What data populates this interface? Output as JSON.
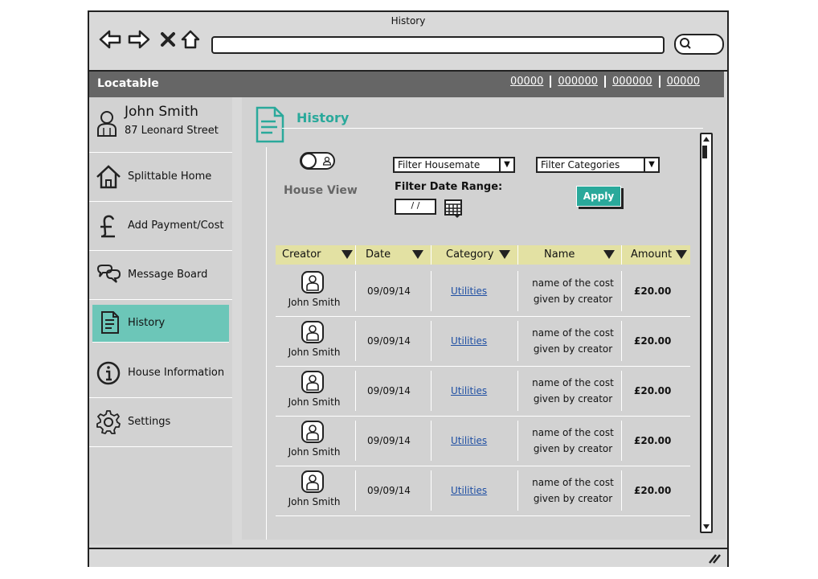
{
  "window": {
    "title": "History"
  },
  "browser": {
    "url": ""
  },
  "app": {
    "brand": "Locatable",
    "top_links": [
      "00000",
      "000000",
      "000000",
      "00000"
    ]
  },
  "sidebar": {
    "user": {
      "name": "John Smith",
      "address": "87 Leonard Street"
    },
    "items": [
      {
        "label": "Splittable Home",
        "icon": "house-icon"
      },
      {
        "label": "Add Payment/Cost",
        "icon": "pound-icon"
      },
      {
        "label": "Message Board",
        "icon": "chat-bubbles-icon"
      },
      {
        "label": "History",
        "icon": "document-icon",
        "active": true
      },
      {
        "label": "House Information",
        "icon": "info-icon"
      },
      {
        "label": "Settings",
        "icon": "gear-icon"
      }
    ]
  },
  "main": {
    "title": "History",
    "house_view_label": "House View",
    "filters": {
      "housemate": "Filter Housemate",
      "categories": "Filter Categories",
      "date_range_label": "Filter Date Range:",
      "date_placeholder": "/ /",
      "apply_label": "Apply"
    },
    "table": {
      "headers": [
        "Creator",
        "Date",
        "Category",
        "Name",
        "Amount"
      ],
      "rows": [
        {
          "creator": "John Smith",
          "date": "09/09/14",
          "category": "Utilities",
          "name_line1": "name of the cost",
          "name_line2": "given by creator",
          "amount": "£20.00"
        },
        {
          "creator": "John Smith",
          "date": "09/09/14",
          "category": "Utilities",
          "name_line1": "name of the cost",
          "name_line2": "given by creator",
          "amount": "£20.00"
        },
        {
          "creator": "John Smith",
          "date": "09/09/14",
          "category": "Utilities",
          "name_line1": "name of the cost",
          "name_line2": "given by creator",
          "amount": "£20.00"
        },
        {
          "creator": "John Smith",
          "date": "09/09/14",
          "category": "Utilities",
          "name_line1": "name of the cost",
          "name_line2": "given by creator",
          "amount": "£20.00"
        },
        {
          "creator": "John Smith",
          "date": "09/09/14",
          "category": "Utilities",
          "name_line1": "name of the cost",
          "name_line2": "given by creator",
          "amount": "£20.00"
        }
      ]
    }
  },
  "colors": {
    "accent": "#2aa99b",
    "active_item": "#6cc6b8",
    "header_row": "#e3e1a3",
    "appbar": "#666666"
  }
}
